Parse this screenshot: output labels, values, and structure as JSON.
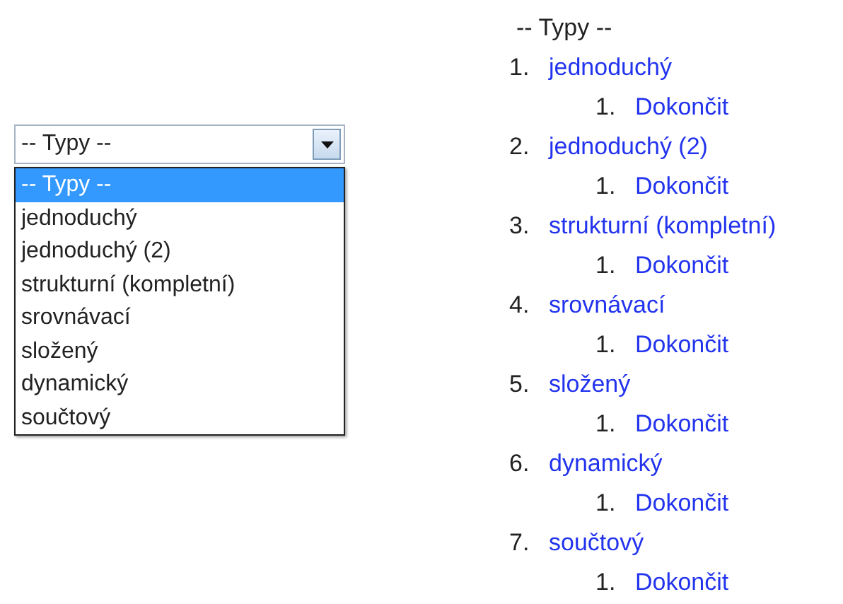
{
  "select": {
    "value": "-- Typy --",
    "options": [
      {
        "label": "-- Typy --",
        "selected": true
      },
      {
        "label": "jednoduchý",
        "selected": false
      },
      {
        "label": "jednoduchý (2)",
        "selected": false
      },
      {
        "label": "strukturní (kompletní)",
        "selected": false
      },
      {
        "label": "srovnávací",
        "selected": false
      },
      {
        "label": "složený",
        "selected": false
      },
      {
        "label": "dynamický",
        "selected": false
      },
      {
        "label": "součtový",
        "selected": false
      }
    ]
  },
  "outline": {
    "heading": "-- Typy --",
    "items": [
      {
        "number": "1.",
        "label": "jednoduchý",
        "children": [
          {
            "number": "1.",
            "label": "Dokončit"
          }
        ]
      },
      {
        "number": "2.",
        "label": "jednoduchý (2)",
        "children": [
          {
            "number": "1.",
            "label": "Dokončit"
          }
        ]
      },
      {
        "number": "3.",
        "label": "strukturní (kompletní)",
        "children": [
          {
            "number": "1.",
            "label": "Dokončit"
          }
        ]
      },
      {
        "number": "4.",
        "label": "srovnávací",
        "children": [
          {
            "number": "1.",
            "label": "Dokončit"
          }
        ]
      },
      {
        "number": "5.",
        "label": "složený",
        "children": [
          {
            "number": "1.",
            "label": "Dokončit"
          }
        ]
      },
      {
        "number": "6.",
        "label": "dynamický",
        "children": [
          {
            "number": "1.",
            "label": "Dokončit"
          }
        ]
      },
      {
        "number": "7.",
        "label": "součtový",
        "children": [
          {
            "number": "1.",
            "label": "Dokončit"
          }
        ]
      }
    ]
  }
}
